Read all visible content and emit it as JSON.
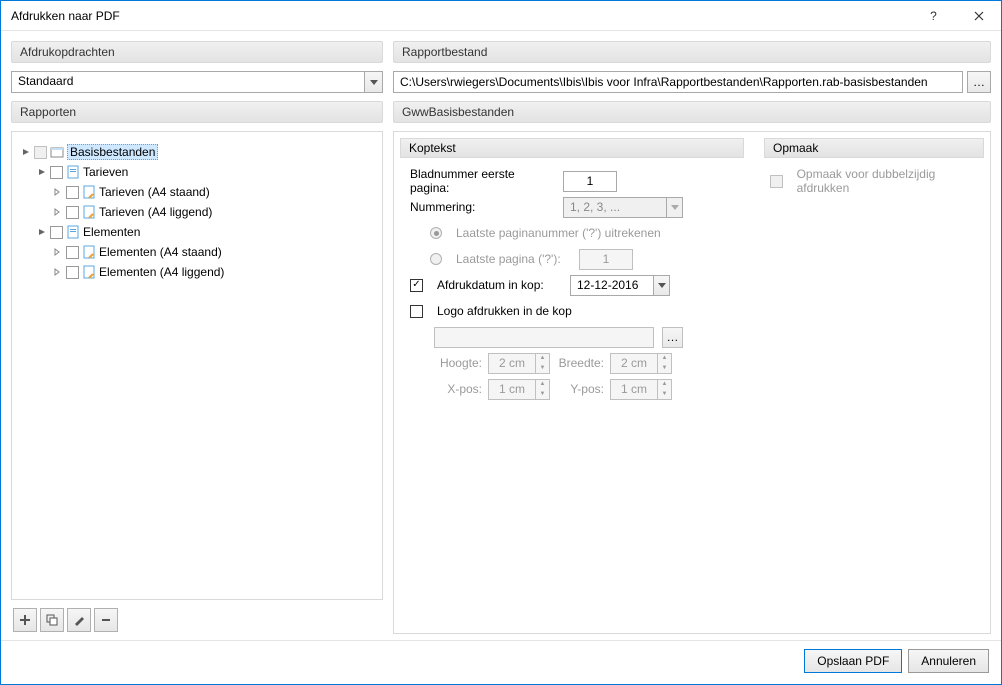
{
  "window": {
    "title": "Afdrukken naar PDF"
  },
  "left": {
    "section_afdruk": "Afdrukopdrachten",
    "afdruk_value": "Standaard",
    "section_rapporten": "Rapporten",
    "tree": {
      "root": "Basisbestanden",
      "tarieven": "Tarieven",
      "tarieven_a4s": "Tarieven (A4 staand)",
      "tarieven_a4l": "Tarieven (A4 liggend)",
      "elementen": "Elementen",
      "elementen_a4s": "Elementen (A4 staand)",
      "elementen_a4l": "Elementen (A4 liggend)"
    }
  },
  "right": {
    "section_rapportbestand": "Rapportbestand",
    "path_value": "C:\\Users\\rwiegers\\Documents\\Ibis\\Ibis voor Infra\\Rapportbestanden\\Rapporten.rab-basisbestanden",
    "section_gww": "GwwBasisbestanden",
    "koptekst": {
      "header": "Koptekst",
      "bladnummer_label": "Bladnummer eerste pagina:",
      "bladnummer_value": "1",
      "nummering_label": "Nummering:",
      "nummering_value": "1, 2, 3, ...",
      "radio1": "Laatste paginanummer ('?') uitrekenen",
      "radio2": "Laatste pagina ('?'):",
      "radio2_value": "1",
      "afdrukdatum_label": "Afdrukdatum in kop:",
      "afdrukdatum_value": "12-12-2016",
      "logo_label": "Logo afdrukken in de kop",
      "hoogte_label": "Hoogte:",
      "hoogte_value": "2 cm",
      "breedte_label": "Breedte:",
      "breedte_value": "2 cm",
      "xpos_label": "X-pos:",
      "xpos_value": "1 cm",
      "ypos_label": "Y-pos:",
      "ypos_value": "1 cm"
    },
    "opmaak": {
      "header": "Opmaak",
      "dubbelzijdig": "Opmaak voor dubbelzijdig afdrukken"
    }
  },
  "footer": {
    "opslaan": "Opslaan PDF",
    "annuleren": "Annuleren"
  }
}
